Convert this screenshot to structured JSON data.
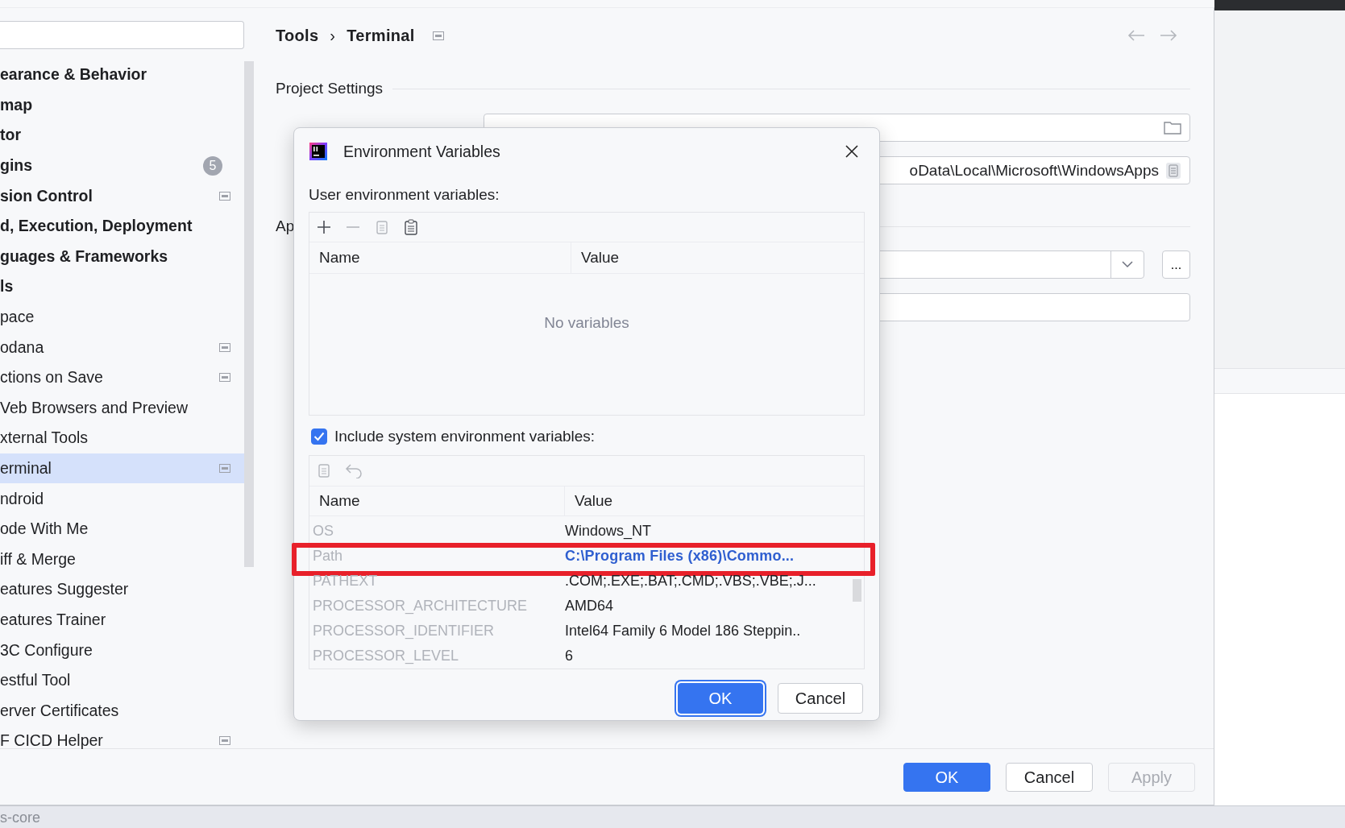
{
  "settings": {
    "sidebar": {
      "items": [
        {
          "label": "earance & Behavior",
          "selected": false,
          "scoped": false
        },
        {
          "label": "map",
          "selected": false,
          "scoped": false
        },
        {
          "label": "tor",
          "selected": false,
          "scoped": false
        },
        {
          "label": "gins",
          "selected": false,
          "scoped": false,
          "badge": "5"
        },
        {
          "label": "sion Control",
          "selected": false,
          "scoped": true
        },
        {
          "label": "d, Execution, Deployment",
          "selected": false,
          "scoped": false
        },
        {
          "label": "guages & Frameworks",
          "selected": false,
          "scoped": false
        },
        {
          "label": "ls",
          "selected": false,
          "scoped": false,
          "children": [
            {
              "label": "pace",
              "selected": false,
              "scoped": false
            },
            {
              "label": "odana",
              "selected": false,
              "scoped": true
            },
            {
              "label": "ctions on Save",
              "selected": false,
              "scoped": true
            },
            {
              "label": "Veb Browsers and Preview",
              "selected": false,
              "scoped": false
            },
            {
              "label": "xternal Tools",
              "selected": false,
              "scoped": false
            },
            {
              "label": "erminal",
              "selected": true,
              "scoped": true
            },
            {
              "label": "ndroid",
              "selected": false,
              "scoped": false
            },
            {
              "label": "ode With Me",
              "selected": false,
              "scoped": false
            },
            {
              "label": "iff & Merge",
              "selected": false,
              "scoped": false
            },
            {
              "label": "eatures Suggester",
              "selected": false,
              "scoped": false
            },
            {
              "label": "eatures Trainer",
              "selected": false,
              "scoped": false
            },
            {
              "label": "3C Configure",
              "selected": false,
              "scoped": false
            },
            {
              "label": "estful Tool",
              "selected": false,
              "scoped": false
            },
            {
              "label": "erver Certificates",
              "selected": false,
              "scoped": false
            },
            {
              "label": "F CICD Helper",
              "selected": false,
              "scoped": true
            }
          ]
        }
      ]
    },
    "breadcrumb": {
      "items": [
        "Tools",
        "Terminal"
      ],
      "separator": "›"
    },
    "project_section": {
      "title": "Project Settings",
      "shell_path": "oData\\Local\\Microsoft\\WindowsApps"
    },
    "app_section": {
      "title": "Ap",
      "more_button": "..."
    },
    "buttons": [
      {
        "label": "OK",
        "kind": "primary",
        "disabled": false
      },
      {
        "label": "Cancel",
        "kind": "default",
        "disabled": false
      },
      {
        "label": "Apply",
        "kind": "default",
        "disabled": true
      }
    ]
  },
  "dialog": {
    "title": "Environment Variables",
    "user_label": "User environment variables:",
    "user_toolbar": [
      {
        "kind": "add",
        "disabled": false
      },
      {
        "kind": "remove",
        "disabled": true
      },
      {
        "kind": "copy",
        "disabled": true
      },
      {
        "kind": "paste",
        "disabled": false
      }
    ],
    "user_columns": [
      "Name",
      "Value"
    ],
    "user_empty": "No variables",
    "include_system": {
      "label": "Include system environment variables:",
      "checked": true
    },
    "system_toolbar": [
      {
        "kind": "copy",
        "disabled": true
      },
      {
        "kind": "undo",
        "disabled": true
      }
    ],
    "system_columns": [
      "Name",
      "Value"
    ],
    "system_rows": [
      {
        "name": "OS",
        "value": "Windows_NT",
        "modified": false,
        "highlighted": false
      },
      {
        "name": "Path",
        "value": "C:\\Program Files (x86)\\Commo...",
        "modified": true,
        "highlighted": true
      },
      {
        "name": "PATHEXT",
        "value": ".COM;.EXE;.BAT;.CMD;.VBS;.VBE;.J...",
        "modified": false,
        "highlighted": false
      },
      {
        "name": "PROCESSOR_ARCHITECTURE",
        "value": "AMD64",
        "modified": false,
        "highlighted": false
      },
      {
        "name": "PROCESSOR_IDENTIFIER",
        "value": "Intel64 Family 6 Model 186 Steppin..",
        "modified": false,
        "highlighted": false
      },
      {
        "name": "PROCESSOR_LEVEL",
        "value": "6",
        "modified": false,
        "highlighted": false
      }
    ],
    "buttons": [
      {
        "label": "OK",
        "kind": "primary",
        "disabled": false
      },
      {
        "label": "Cancel",
        "kind": "default",
        "disabled": false
      }
    ]
  },
  "status_bar": {
    "text": "s-core"
  }
}
